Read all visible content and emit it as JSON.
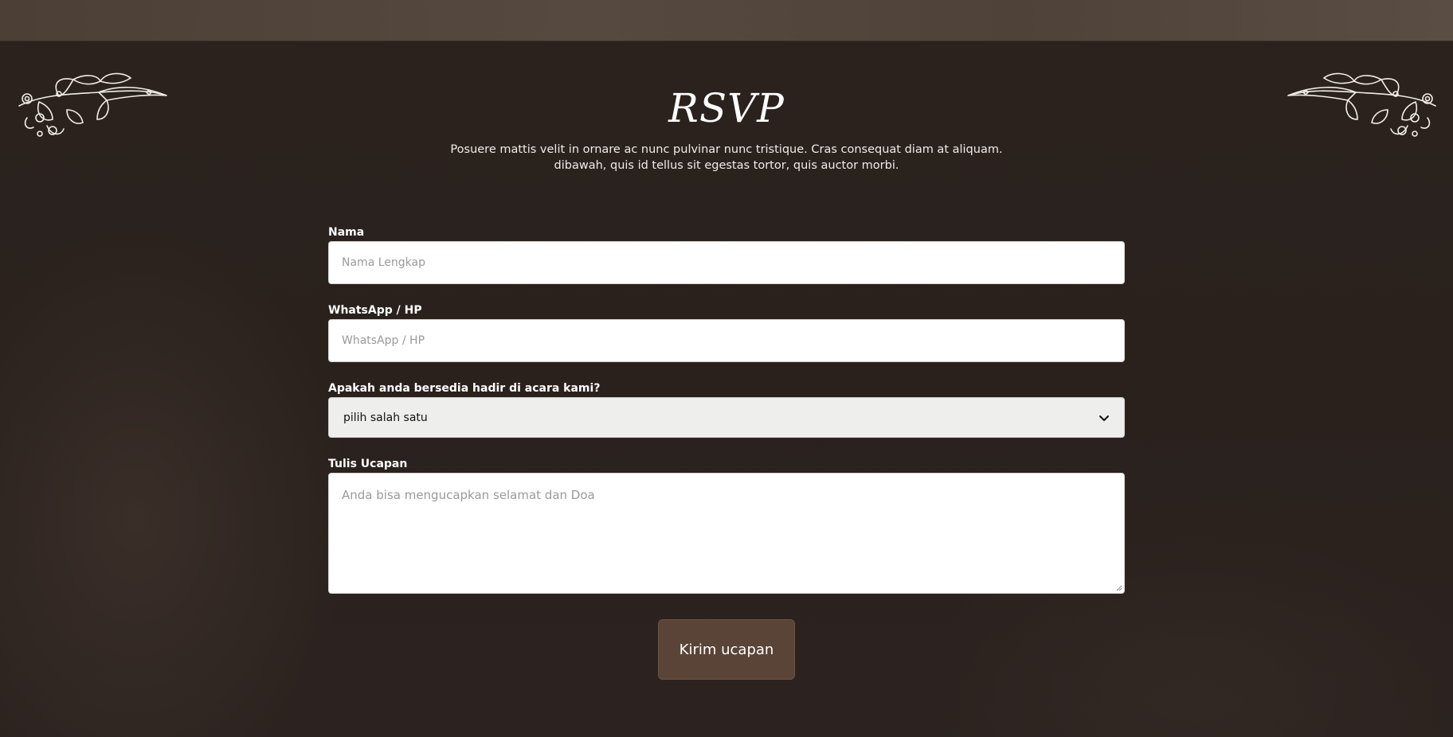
{
  "rsvp": {
    "title": "RSVP",
    "subtitle_line1": "Posuere mattis velit in ornare ac nunc pulvinar nunc tristique. Cras consequat diam at aliquam.",
    "subtitle_line2": "dibawah, quis id tellus sit egestas tortor, quis auctor morbi."
  },
  "form": {
    "name": {
      "label": "Nama",
      "placeholder": "Nama Lengkap"
    },
    "phone": {
      "label": "WhatsApp / HP",
      "placeholder": "WhatsApp / HP"
    },
    "attendance": {
      "label": "Apakah anda bersedia hadir di acara kami?",
      "selected": "pilih salah satu"
    },
    "message": {
      "label": "Tulis Ucapan",
      "placeholder": "Anda bisa mengucapkan selamat dan Doa"
    },
    "submit_label": "Kirim ucapan"
  },
  "colors": {
    "background": "#2a211e",
    "button": "#5a4437",
    "select_bg": "#eeeeed"
  },
  "icons": {
    "ornament": "floral-vine-icon",
    "select_arrow": "chevron-down-icon"
  }
}
